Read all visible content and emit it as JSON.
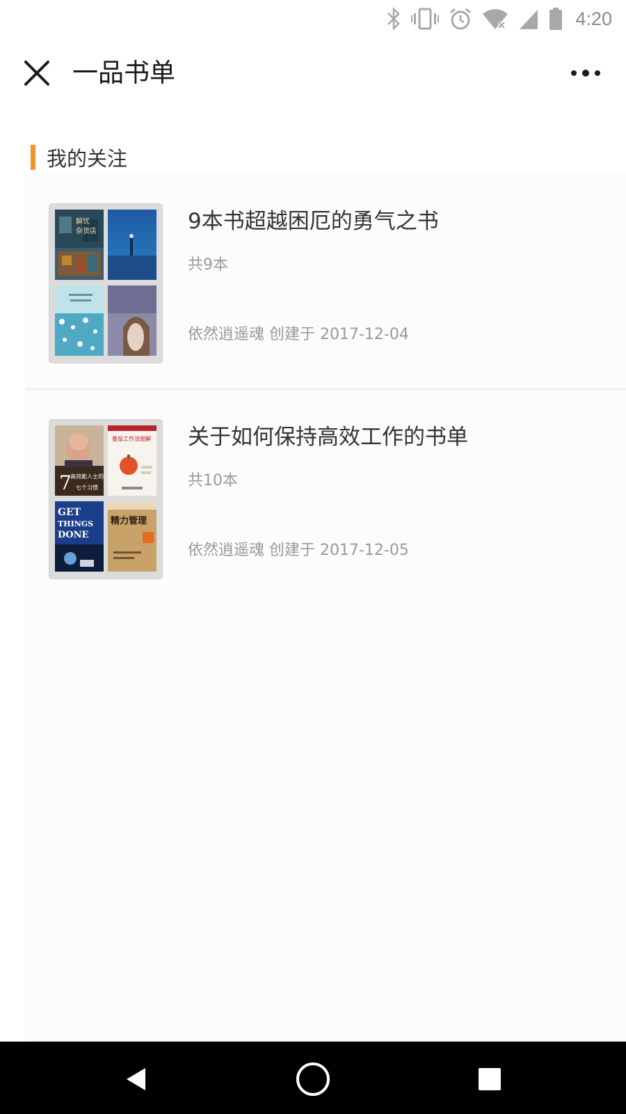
{
  "status_bar": {
    "time": "4:20",
    "icons": [
      "bluetooth-icon",
      "vibrate-icon",
      "alarm-icon",
      "wifi-off-icon",
      "signal-icon",
      "battery-icon"
    ]
  },
  "header": {
    "title": "一品书单",
    "close_icon": "close-icon",
    "more_icon": "more-icon"
  },
  "section": {
    "title": "我的关注",
    "accent_color": "#f0942c"
  },
  "booklists": [
    {
      "title": "9本书超越困厄的勇气之书",
      "count": "共9本",
      "meta": "依然逍遥魂 创建于 2017-12-04",
      "covers": [
        {
          "label": "解忧杂货店"
        },
        {
          "label": ""
        },
        {
          "label": ""
        },
        {
          "label": ""
        }
      ]
    },
    {
      "title": "关于如何保持高效工作的书单",
      "count": "共10本",
      "meta": "依然逍遥魂 创建于 2017-12-05",
      "covers": [
        {
          "label": "高效能人士的七个习惯",
          "big": "7"
        },
        {
          "label": "番茄工作法图解"
        },
        {
          "label": "GET THINGS DONE"
        },
        {
          "label": "精力管理"
        }
      ]
    }
  ],
  "nav_bar": {
    "icons": [
      "back-icon",
      "home-icon",
      "recents-icon"
    ]
  }
}
